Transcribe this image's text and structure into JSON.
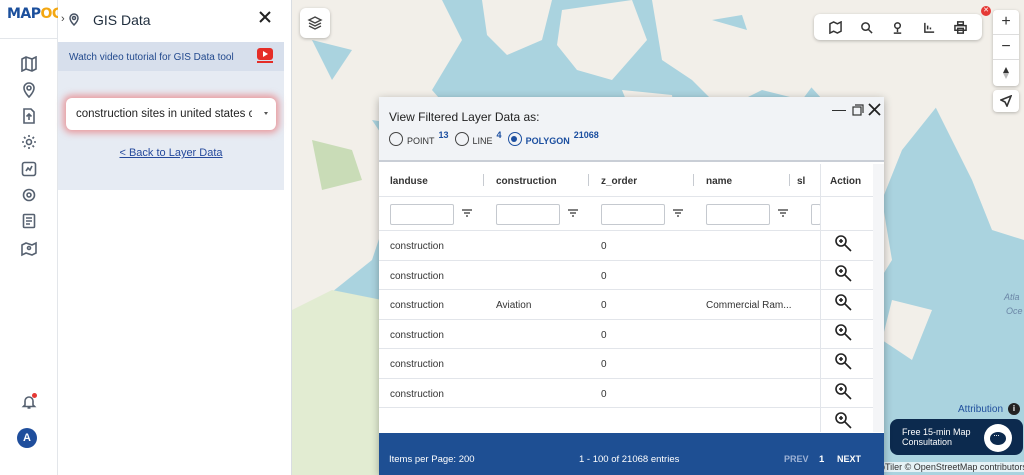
{
  "brand": {
    "logo_main": "MAP",
    "logo_accent": "OG",
    "primary_color": "#1b4f9c",
    "accent_color": "#f3a712"
  },
  "rail": {
    "icons": [
      "map-icon",
      "location-pin-icon",
      "upload-file-icon",
      "gear-icon",
      "map-analysis-icon",
      "settings-cog-icon",
      "report-icon",
      "map-pin-icon"
    ],
    "bell_icon": "bell-icon",
    "avatar_letter": "A"
  },
  "panel": {
    "title": "GIS Data",
    "tutorial_text": "Watch video tutorial for GIS Data tool",
    "layer_select_value": "construction sites in united states c",
    "back_link": "< Back to Layer Data"
  },
  "map": {
    "labels": {
      "ocean": "Atla",
      "ocean2": "Oce"
    },
    "attribution_label": "Attribution",
    "attribution_text": "pTiler © OpenStreetMap contributors",
    "consult_text": "Free 15-min Map Consultation",
    "zoom_in": "+",
    "zoom_out": "−"
  },
  "popup": {
    "title": "View Filtered Layer Data as:",
    "geometry_types": [
      {
        "label": "POINT",
        "count": "13",
        "selected": false
      },
      {
        "label": "LINE",
        "count": "4",
        "selected": false
      },
      {
        "label": "POLYGON",
        "count": "21068",
        "selected": true
      }
    ],
    "columns": [
      "landuse",
      "construction",
      "z_order",
      "name",
      "sl",
      "Action"
    ],
    "rows": [
      {
        "landuse": "construction",
        "construction": "",
        "z_order": "0",
        "name": ""
      },
      {
        "landuse": "construction",
        "construction": "",
        "z_order": "0",
        "name": ""
      },
      {
        "landuse": "construction",
        "construction": "Aviation",
        "z_order": "0",
        "name": "Commercial Ram..."
      },
      {
        "landuse": "construction",
        "construction": "",
        "z_order": "0",
        "name": ""
      },
      {
        "landuse": "construction",
        "construction": "",
        "z_order": "0",
        "name": ""
      },
      {
        "landuse": "construction",
        "construction": "",
        "z_order": "0",
        "name": ""
      }
    ],
    "footer": {
      "items_per_page": "Items per Page: 200",
      "range": "1 - 100 of 21068 entries",
      "prev": "PREV",
      "page": "1",
      "next": "NEXT"
    }
  }
}
